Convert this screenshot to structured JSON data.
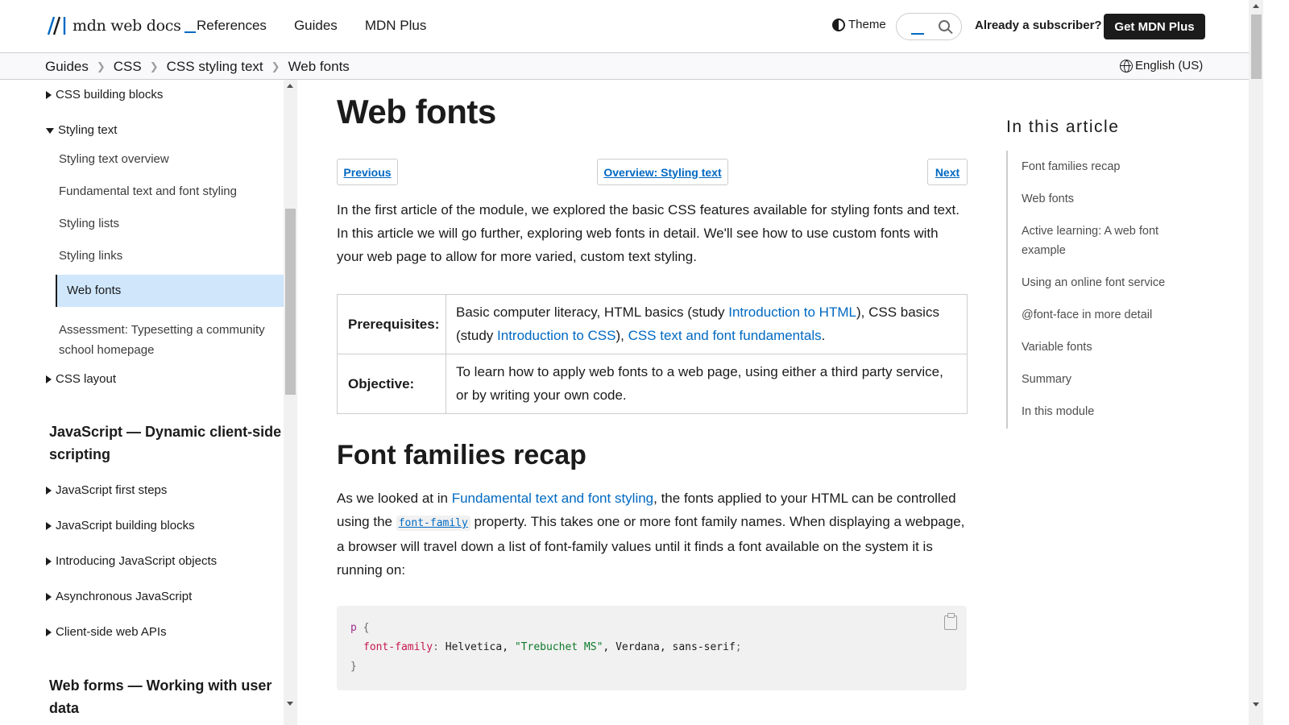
{
  "header": {
    "logo_text": "mdn web docs",
    "nav": [
      "References",
      "Guides",
      "MDN Plus"
    ],
    "theme_label": "Theme",
    "subscriber_link": "Already a subscriber?",
    "cta_label": "Get MDN Plus"
  },
  "breadcrumb": [
    "Guides",
    "CSS",
    "CSS styling text",
    "Web fonts"
  ],
  "language": "English (US)",
  "sidebar": {
    "building_blocks": "CSS building blocks",
    "styling_text": "Styling text",
    "sub_items": [
      "Styling text overview",
      "Fundamental text and font styling",
      "Styling lists",
      "Styling links"
    ],
    "active_item": "Web fonts",
    "assessment_line1": "Assessment: Typesetting a community",
    "assessment_line2": "school homepage",
    "css_layout": "CSS layout",
    "js_heading": "JavaScript — Dynamic client-side scripting",
    "js_items": [
      "JavaScript first steps",
      "JavaScript building blocks",
      "Introducing JavaScript objects",
      "Asynchronous JavaScript",
      "Client-side web APIs"
    ],
    "forms_heading": "Web forms — Working with user data"
  },
  "article": {
    "title": "Web fonts",
    "prev_label": "Previous",
    "overview_label": "Overview: Styling text",
    "next_label": "Next",
    "intro": "In the first article of the module, we explored the basic CSS features available for styling fonts and text. In this article we will go further, exploring web fonts in detail. We'll see how to use custom fonts with your web page to allow for more varied, custom text styling.",
    "prereq": {
      "label": "Prerequisites:",
      "text_a": "Basic computer literacy, HTML basics (study ",
      "link_a": "Introduction to HTML",
      "text_b": "), CSS basics (study ",
      "link_b": "Introduction to CSS",
      "text_c": "), ",
      "link_c": "CSS text and font fundamentals",
      "text_d": "."
    },
    "objective": {
      "label": "Objective:",
      "text": "To learn how to apply web fonts to a web page, using either a third party service, or by writing your own code."
    },
    "section_heading": "Font families recap",
    "para": {
      "text_a": "As we looked at in ",
      "link": "Fundamental text and font styling",
      "text_b": ", the fonts applied to your HTML can be controlled using the ",
      "code": "font-family",
      "text_c": " property. This takes one or more font family names. When displaying a webpage, a browser will travel down a list of font-family values until it finds a font available on the system it is running on:"
    },
    "code": {
      "selector": "p",
      "open_brace": "{",
      "property": "font-family",
      "colon": ":",
      "value_a": " Helvetica, ",
      "value_str": "\"Trebuchet MS\"",
      "value_b": ", Verdana, sans-serif",
      "semicolon": ";",
      "close_brace": "}"
    }
  },
  "toc": {
    "title": "In this article",
    "items": [
      "Font families recap",
      "Web fonts",
      "Active learning: A web font example",
      "Using an online font service",
      "@font-face in more detail",
      "Variable fonts",
      "Summary",
      "In this module"
    ]
  }
}
